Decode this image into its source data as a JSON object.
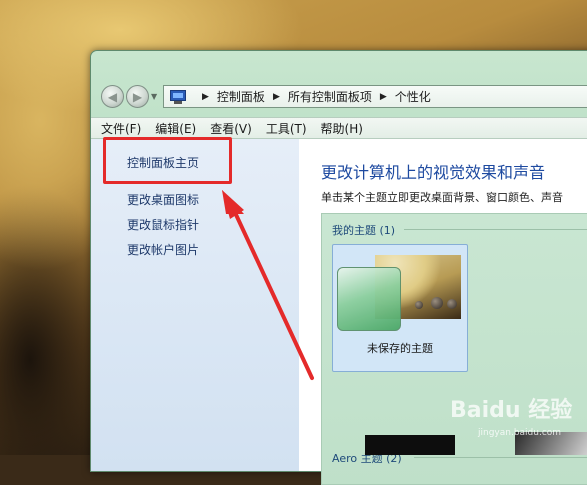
{
  "address_bar": {
    "icon": "control-panel-icon",
    "breadcrumbs": [
      "控制面板",
      "所有控制面板项",
      "个性化"
    ]
  },
  "menu": [
    "文件(F)",
    "编辑(E)",
    "查看(V)",
    "工具(T)",
    "帮助(H)"
  ],
  "sidebar": {
    "items": [
      {
        "label": "控制面板主页"
      },
      {
        "label": "更改桌面图标"
      },
      {
        "label": "更改鼠标指针"
      },
      {
        "label": "更改帐户图片"
      }
    ]
  },
  "main": {
    "title": "更改计算机上的视觉效果和声音",
    "description": "单击某个主题立即更改桌面背景、窗口颜色、声音",
    "my_themes_label": "我的主题 (1)",
    "unsaved_theme_label": "未保存的主题",
    "aero_themes_label": "Aero 主题 (2)"
  },
  "annotation": {
    "color": "#e42a2a"
  },
  "watermark": {
    "logo": "Baidu 经验",
    "sub": "jingyan.baidu.com"
  }
}
